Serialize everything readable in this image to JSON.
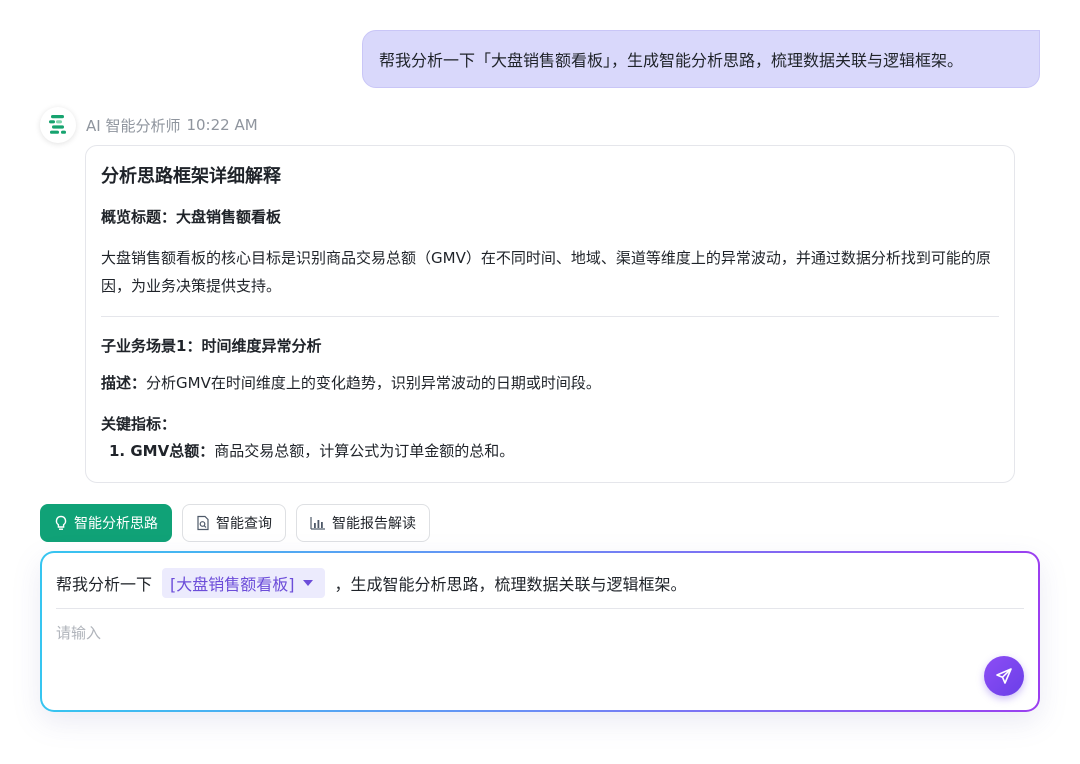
{
  "user_message": "帮我分析一下「大盘销售额看板」，生成智能分析思路，梳理数据关联与逻辑框架。",
  "assistant": {
    "name": "AI 智能分析师",
    "time": "10:22 AM",
    "card": {
      "title": "分析思路框架详细解释",
      "overview_heading": "概览标题：大盘销售额看板",
      "overview_body": "大盘销售额看板的核心目标是识别商品交易总额（GMV）在不同时间、地域、渠道等维度上的异常波动，并通过数据分析找到可能的原因，为业务决策提供支持。",
      "scenario_heading": "子业务场景1：时间维度异常分析",
      "desc_label": "描述：",
      "desc_text": "分析GMV在时间维度上的变化趋势，识别异常波动的日期或时间段。",
      "metrics_heading": "关键指标：",
      "metric_1_label": "1. GMV总额：",
      "metric_1_text": "商品交易总额，计算公式为订单金额的总和。"
    }
  },
  "action_chips": [
    {
      "label": "智能分析思路",
      "icon": "bulb-icon",
      "active": true
    },
    {
      "label": "智能查询",
      "icon": "search-doc-icon",
      "active": false
    },
    {
      "label": "智能报告解读",
      "icon": "bar-chart-icon",
      "active": false
    }
  ],
  "composer": {
    "prefix": "帮我分析一下",
    "tag_label": "[大盘销售额看板]",
    "suffix": "，生成智能分析思路，梳理数据关联与逻辑框架。",
    "placeholder": "请输入"
  },
  "colors": {
    "primary_green": "#10a277",
    "accent_purple": "#6c4dd9",
    "user_bubble": "#d9d8fb"
  }
}
